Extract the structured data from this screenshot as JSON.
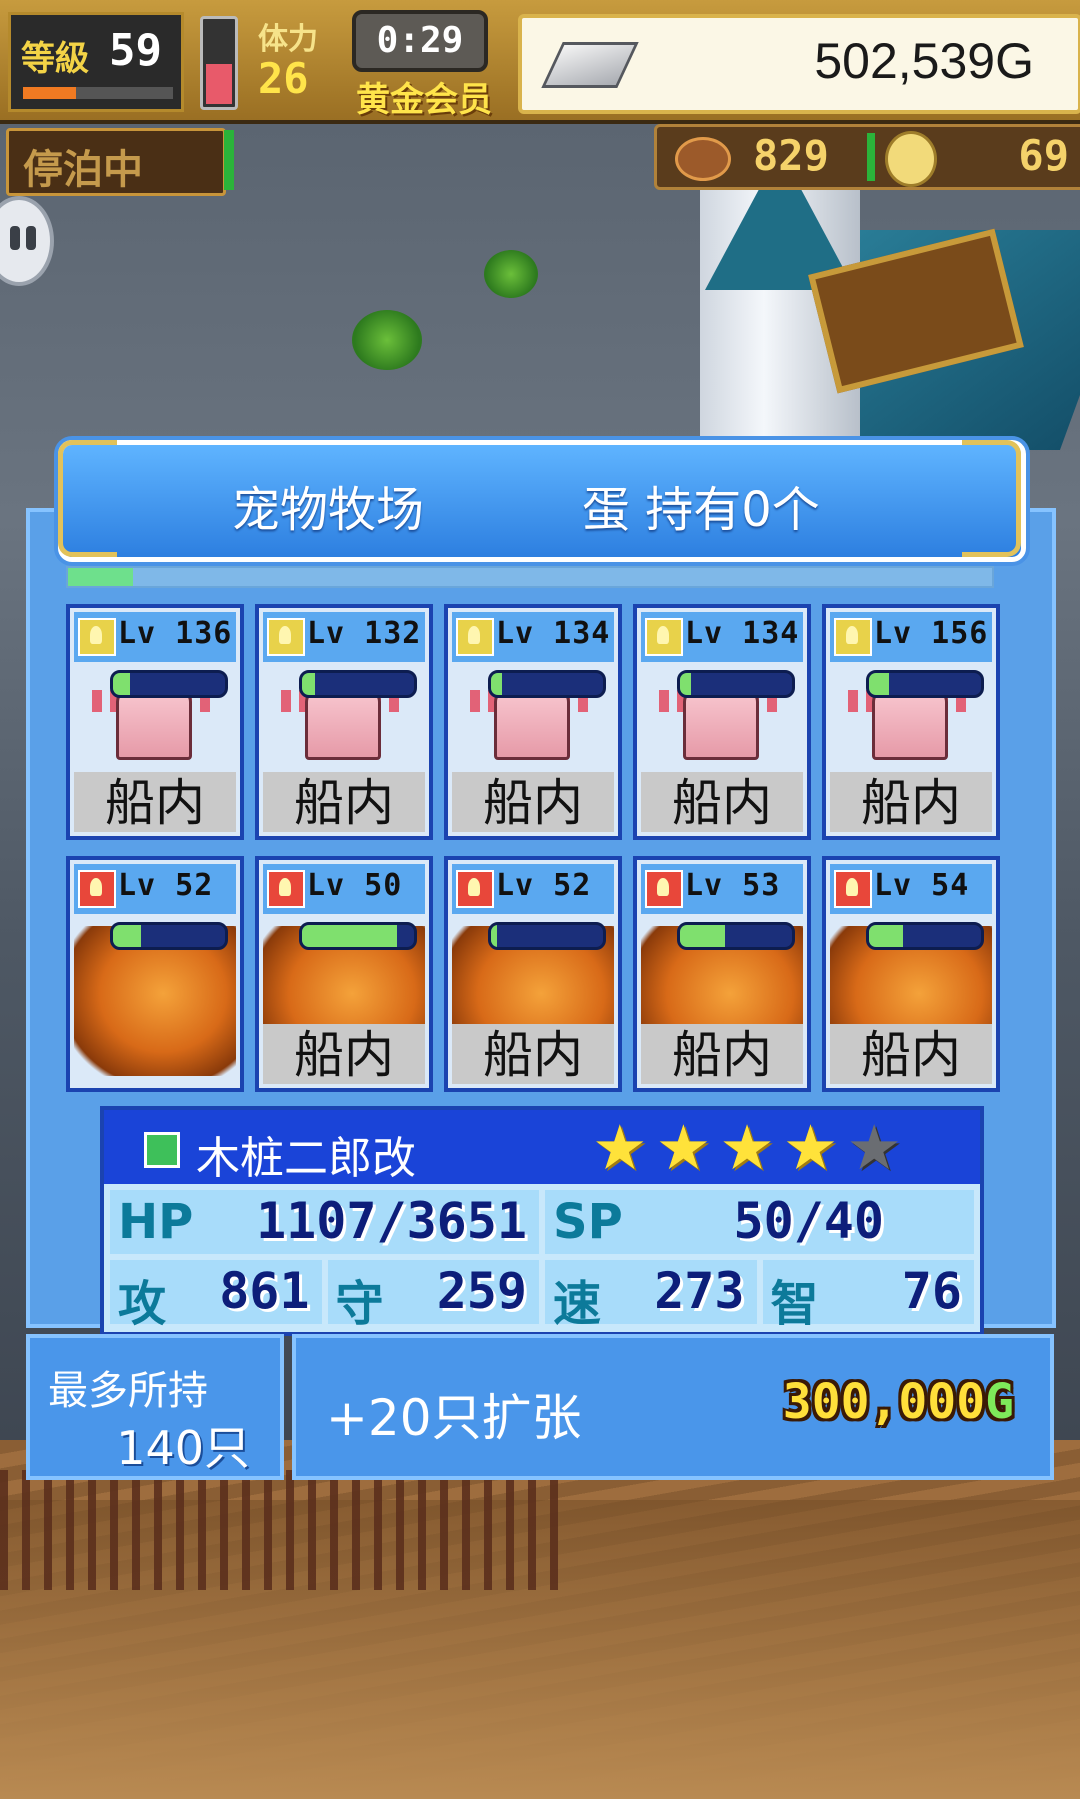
{
  "hud": {
    "level_label": "等級",
    "level": "59",
    "level_progress": 0.35,
    "stamina_label": "体力",
    "stamina": "26",
    "stamina_level": 0.45,
    "timer": "0:29",
    "membership": "黄金会员",
    "gold": "502,539G",
    "dock_status": "停泊中",
    "resource1": "829",
    "resource2": "69"
  },
  "panel": {
    "title": "宠物牧场",
    "eggs": "蛋 持有0个",
    "progress": 0.07
  },
  "pets": [
    {
      "element": "thunder",
      "lv": "Lv 136",
      "hp": 0.15,
      "kind": "axolotl",
      "location": "船内"
    },
    {
      "element": "thunder",
      "lv": "Lv 132",
      "hp": 0.12,
      "kind": "axolotl",
      "location": "船内"
    },
    {
      "element": "thunder",
      "lv": "Lv 134",
      "hp": 0.1,
      "kind": "axolotl",
      "location": "船内"
    },
    {
      "element": "thunder",
      "lv": "Lv 134",
      "hp": 0.1,
      "kind": "axolotl",
      "location": "船内"
    },
    {
      "element": "thunder",
      "lv": "Lv 156",
      "hp": 0.18,
      "kind": "axolotl",
      "location": "船内"
    },
    {
      "element": "fire",
      "lv": "Lv 52",
      "hp": 0.25,
      "kind": "dragon",
      "location": ""
    },
    {
      "element": "fire",
      "lv": "Lv 50",
      "hp": 0.85,
      "kind": "dragon",
      "location": "船内"
    },
    {
      "element": "fire",
      "lv": "Lv 52",
      "hp": 0.05,
      "kind": "dragon",
      "location": "船内"
    },
    {
      "element": "fire",
      "lv": "Lv 53",
      "hp": 0.4,
      "kind": "dragon",
      "location": "船内"
    },
    {
      "element": "fire",
      "lv": "Lv 54",
      "hp": 0.3,
      "kind": "dragon",
      "location": "船内"
    }
  ],
  "selected": {
    "name": "木桩二郎改",
    "stars": 4,
    "max_stars": 5,
    "hp_label": "HP",
    "hp": "1107/3651",
    "sp_label": "SP",
    "sp": "50/40",
    "atk_label": "攻",
    "atk": "861",
    "def_label": "守",
    "def": "259",
    "spd_label": "速",
    "spd": "273",
    "int_label": "智",
    "int": "76"
  },
  "capacity": {
    "label": "最多所持",
    "value": "140只"
  },
  "expand": {
    "label": "+20只扩张",
    "price": "300,000",
    "price_unit": "G"
  },
  "colors": {
    "panel_blue": "#5aa0e8",
    "card_border": "#1b43b0",
    "star_on": "#ffe23a",
    "gold_text": "#ffdf3a"
  }
}
